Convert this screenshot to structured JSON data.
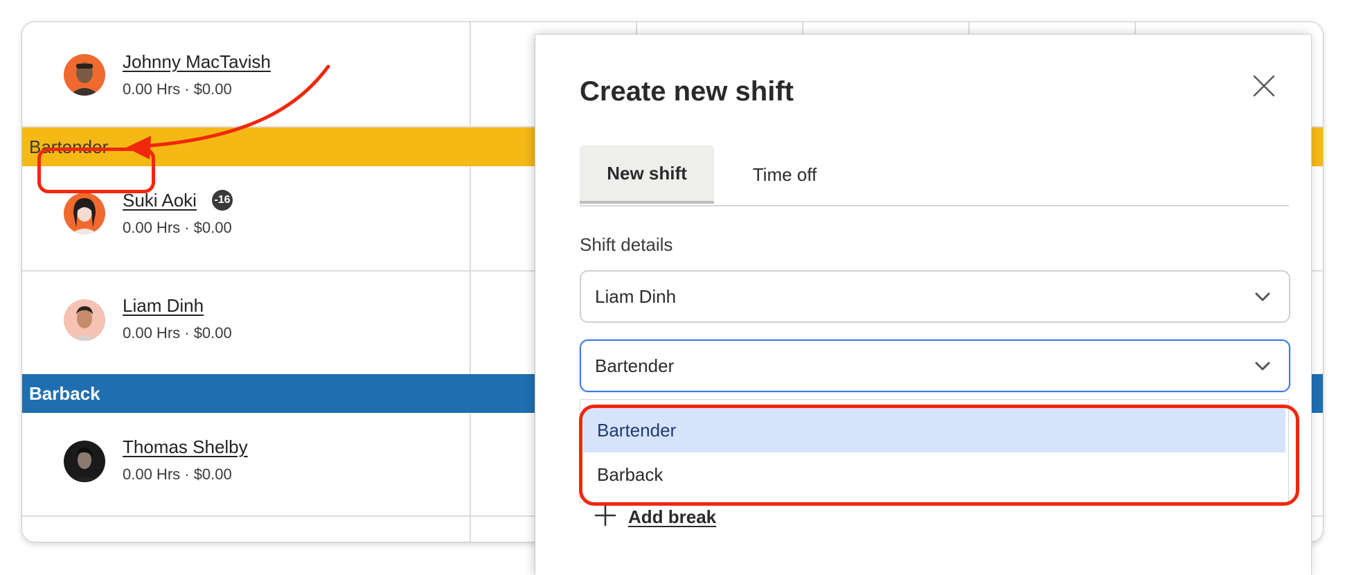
{
  "schedule": {
    "employees": [
      {
        "name": "Johnny MacTavish",
        "summary": "0.00 Hrs · $0.00"
      },
      {
        "name": "Suki Aoki",
        "summary": "0.00 Hrs · $0.00",
        "badge": "-16"
      },
      {
        "name": "Liam Dinh",
        "summary": "0.00 Hrs · $0.00"
      },
      {
        "name": "Thomas Shelby",
        "summary": "0.00 Hrs · $0.00"
      }
    ],
    "groups": [
      {
        "label": "Bartender",
        "color": "#f4b915"
      },
      {
        "label": "Barback",
        "color": "#1f6fb0"
      }
    ]
  },
  "modal": {
    "title": "Create new shift",
    "tabs": [
      {
        "label": "New shift",
        "active": true
      },
      {
        "label": "Time off",
        "active": false
      }
    ],
    "section_label": "Shift details",
    "employee_select": {
      "value": "Liam Dinh"
    },
    "role_select": {
      "value": "Bartender"
    },
    "role_options": [
      {
        "label": "Bartender",
        "selected": true
      },
      {
        "label": "Barback",
        "selected": false
      }
    ],
    "add_break_label": "Add break"
  },
  "icons": {
    "close": "close-icon",
    "chevron": "chevron-down-icon",
    "plus": "plus-icon"
  },
  "colors": {
    "annotation": "#f0280c",
    "focus_border": "#3b78e7",
    "option_highlight": "#d7e3fb"
  }
}
